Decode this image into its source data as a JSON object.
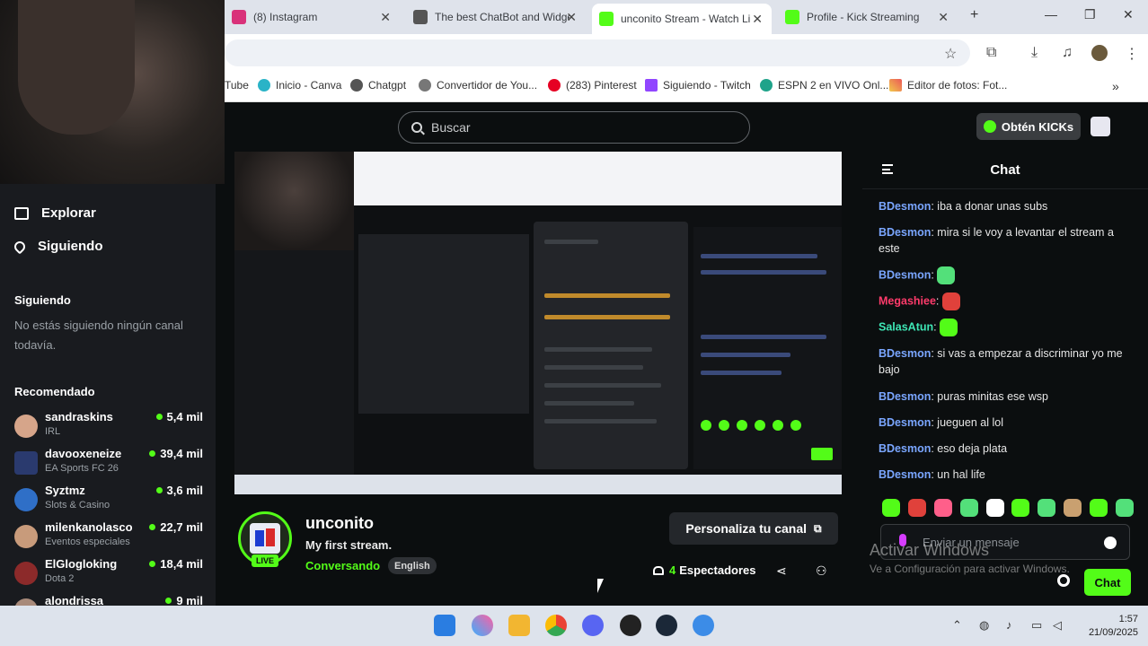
{
  "browser": {
    "tabs": [
      {
        "title": "(8) Instagram"
      },
      {
        "title": "The best ChatBot and Widge"
      },
      {
        "title": "unconito Stream - Watch Li"
      },
      {
        "title": "Profile - Kick Streaming"
      }
    ],
    "new_tab": "+",
    "bookmarks": [
      "Tube",
      "Inicio - Canva",
      "Chatgpt",
      "Convertidor de You...",
      "(283) Pinterest",
      "Siguiendo - Twitch",
      "ESPN 2 en VIVO Onl...",
      "Editor de fotos: Fot..."
    ]
  },
  "header": {
    "search_placeholder": "Buscar",
    "kicks_label": "Obtén KICKs"
  },
  "sidebar": {
    "nav": [
      {
        "label": "Explorar"
      },
      {
        "label": "Siguiendo"
      }
    ],
    "following_title": "Siguiendo",
    "following_empty": "No estás siguiendo ningún canal todavía.",
    "recommended_title": "Recomendado",
    "recommended": [
      {
        "name": "sandraskins",
        "category": "IRL",
        "viewers": "5,4 mil"
      },
      {
        "name": "davooxeneize",
        "category": "EA Sports FC 26",
        "viewers": "39,4 mil"
      },
      {
        "name": "Syztmz",
        "category": "Slots & Casino",
        "viewers": "3,6 mil"
      },
      {
        "name": "milenkanolasco",
        "category": "Eventos especiales",
        "viewers": "22,7 mil"
      },
      {
        "name": "ElGlogloking",
        "category": "Dota 2",
        "viewers": "18,4 mil"
      },
      {
        "name": "alondrissa",
        "category": "",
        "viewers": "9 mil"
      }
    ]
  },
  "channel": {
    "name": "unconito",
    "title": "My first stream.",
    "category": "Conversando",
    "language": "English",
    "live_badge": "LIVE",
    "customize_label": "Personaliza tu canal",
    "viewers_count": "4",
    "viewers_label": "Espectadores"
  },
  "chat": {
    "title": "Chat",
    "messages": [
      {
        "user": "BDesmon",
        "text": "iba a donar unas subs",
        "color": "#7aa6ff"
      },
      {
        "user": "BDesmon",
        "text": "mira si le voy a levantar el stream a este",
        "color": "#7aa6ff"
      },
      {
        "user": "BDesmon",
        "text": "",
        "color": "#7aa6ff"
      },
      {
        "user": "Megashiee",
        "text": "",
        "color": "#ff3b6b"
      },
      {
        "user": "SalasAtun",
        "text": "",
        "color": "#3ee6b5"
      },
      {
        "user": "BDesmon",
        "text": "si vas a empezar a discriminar yo me bajo",
        "color": "#7aa6ff"
      },
      {
        "user": "BDesmon",
        "text": "puras minitas ese wsp",
        "color": "#7aa6ff"
      },
      {
        "user": "BDesmon",
        "text": "jueguen al lol",
        "color": "#7aa6ff"
      },
      {
        "user": "BDesmon",
        "text": "eso deja plata",
        "color": "#7aa6ff"
      },
      {
        "user": "BDesmon",
        "text": "un hal life",
        "color": "#7aa6ff"
      }
    ],
    "input_placeholder": "Enviar un mensaje",
    "send_label": "Chat"
  },
  "watermark": {
    "line1": "Activar Windows",
    "line2": "Ve a Configuración para activar Windows."
  },
  "taskbar": {
    "time": "1:57",
    "date": "21/09/2025"
  },
  "colors": {
    "accent": "#53fc18",
    "background": "#0b0e0f",
    "sidebar": "#191b1f"
  }
}
